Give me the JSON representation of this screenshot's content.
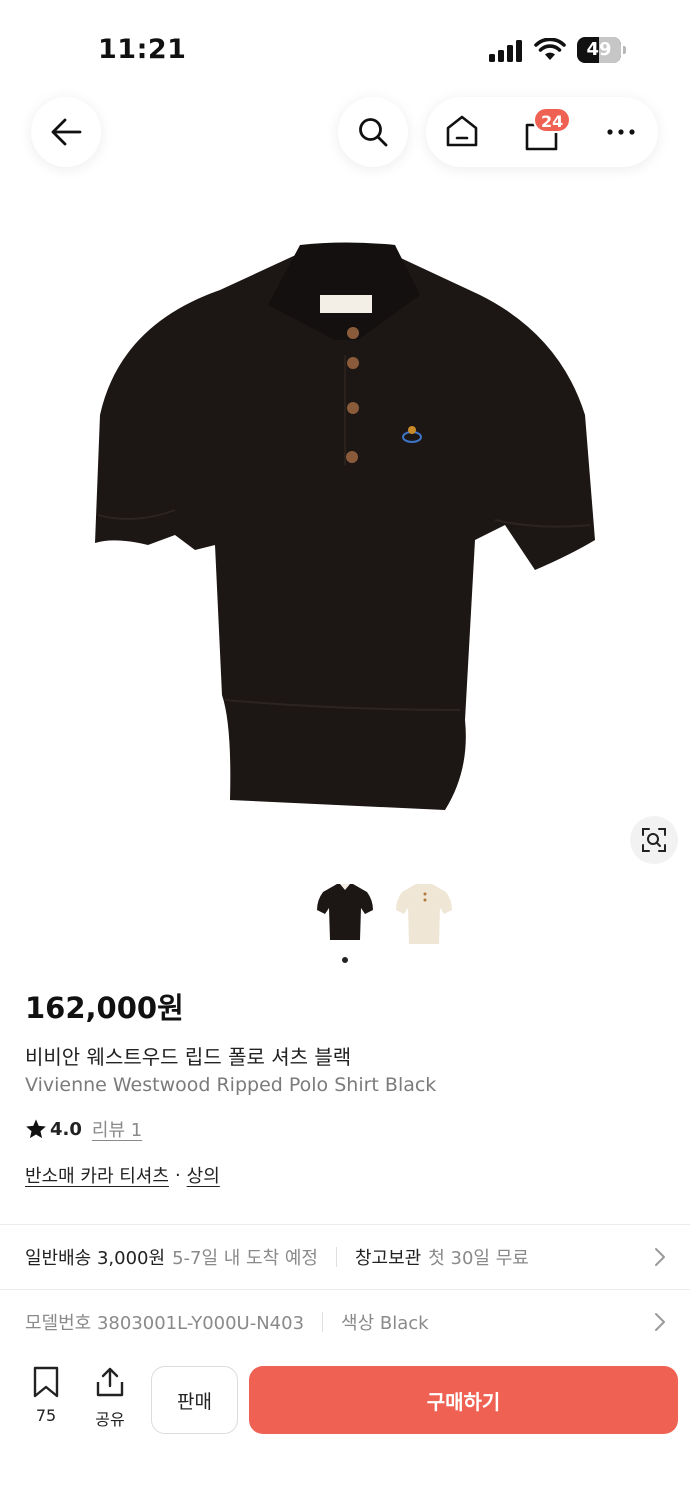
{
  "status": {
    "time": "11:21",
    "battery": "49",
    "battery_level": 0.49
  },
  "nav": {
    "back_icon": "arrow-left-icon",
    "search_icon": "search-icon",
    "home_icon": "home-icon",
    "cart_icon": "shopping-bag-icon",
    "cart_count": "24",
    "more_icon": "more-horizontal-icon"
  },
  "gallery": {
    "lens_icon": "image-search-icon",
    "thumbnails": [
      {
        "color": "#1c1614",
        "name": "black"
      },
      {
        "color": "#efe6d6",
        "name": "cream"
      }
    ],
    "active_index": 0
  },
  "product": {
    "price": "162,000원",
    "title_ko": "비비안 웨스트우드 립드 폴로 셔츠 블랙",
    "title_en": "Vivienne Westwood Ripped Polo Shirt Black",
    "rating": "4.0",
    "review_label": "리뷰 1",
    "category_1": "반소매 카라 티셔츠",
    "category_separator": "·",
    "category_2": "상의"
  },
  "shipping": {
    "label": "일반배송 3,000원",
    "detail": "5-7일 내 도착 예정",
    "storage_label": "창고보관",
    "storage_detail": "첫 30일 무료"
  },
  "model": {
    "label": "모델번호 3803001L-Y000U-N403",
    "color_label": "색상 Black"
  },
  "bottom_bar": {
    "bookmark_count": "75",
    "share_label": "공유",
    "sell_label": "판매",
    "buy_label": "구매하기"
  },
  "colors": {
    "accent": "#ef6253",
    "muted": "#8a8a8a",
    "divider": "#ececec"
  }
}
